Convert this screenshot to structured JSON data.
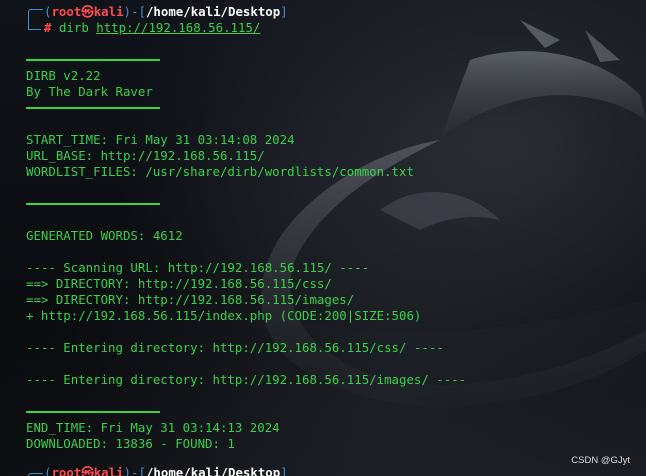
{
  "prompt": {
    "user_host_open": "(",
    "user": "root",
    "at_symbol": "㉿",
    "host": "kali",
    "dash_open": ")-[",
    "path": "/home/kali/Desktop",
    "bracket_close": "]",
    "hash": "#",
    "command": "dirb",
    "command_arg": "http://192.168.56.115/"
  },
  "output": {
    "banner_version": "DIRB v2.22",
    "banner_author": "By The Dark Raver",
    "start_time": "START_TIME: Fri May 31 03:14:08 2024",
    "url_base": "URL_BASE: http://192.168.56.115/",
    "wordlist": "WORDLIST_FILES: /usr/share/dirb/wordlists/common.txt",
    "generated_words": "GENERATED WORDS: 4612",
    "scanning": "---- Scanning URL: http://192.168.56.115/ ----",
    "dir1": "==> DIRECTORY: http://192.168.56.115/css/",
    "dir2": "==> DIRECTORY: http://192.168.56.115/images/",
    "found_file": "+ http://192.168.56.115/index.php (CODE:200|SIZE:506)",
    "entering1": "---- Entering directory: http://192.168.56.115/css/ ----",
    "entering2": "---- Entering directory: http://192.168.56.115/images/ ----",
    "end_time": "END_TIME: Fri May 31 03:14:13 2024",
    "downloaded": "DOWNLOADED: 13836 - FOUND: 1"
  },
  "next_prompt": {
    "user": "root",
    "at_symbol": "㉿",
    "host": "kali",
    "path": "/home/kali/Desktop"
  },
  "watermark": "CSDN @GJyt",
  "colors": {
    "green": "#38d14a",
    "blue": "#3b8fd8",
    "red": "#ff4b4b",
    "background": "#0a0c10"
  }
}
